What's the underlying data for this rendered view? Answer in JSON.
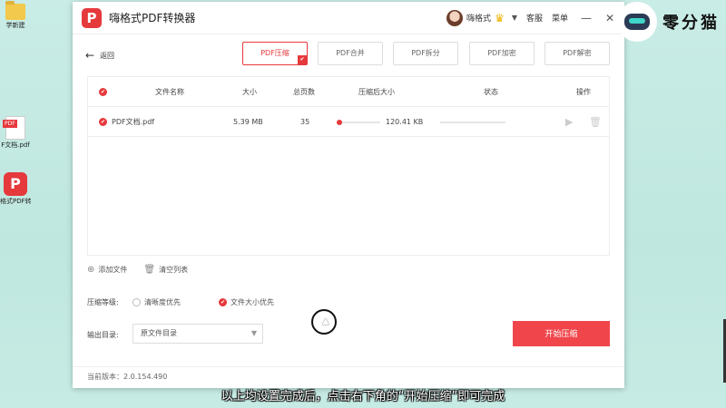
{
  "desktop": {
    "icons": [
      {
        "label": "学新建",
        "icon": "folder-icon"
      },
      {
        "label": "F文档.pdf",
        "icon": "pdf-file-icon",
        "badge": "PDF"
      },
      {
        "label": "格式PDF转换器",
        "icon": "app-icon"
      }
    ]
  },
  "window": {
    "logo_glyph": "P",
    "title": "嗨格式PDF转换器",
    "user": {
      "name": "嗨格式"
    },
    "links": {
      "support": "客服",
      "menu": "菜单"
    },
    "controls": {
      "minimize": "—",
      "close": "✕"
    }
  },
  "toolbar": {
    "back_label": "返回",
    "tabs": [
      "PDF压缩",
      "PDF合并",
      "PDF拆分",
      "PDF加密",
      "PDF解密"
    ],
    "active_tab": 0
  },
  "table": {
    "headers": [
      "文件名称",
      "大小",
      "总页数",
      "压缩后大小",
      "状态",
      "操作"
    ],
    "rows": [
      {
        "name": "PDF文档.pdf",
        "size": "5.39 MB",
        "pages": "35",
        "compressed_size": "120.41 KB",
        "progress": 0
      }
    ]
  },
  "actions": {
    "add_file": "添加文件",
    "clear_list": "清空列表"
  },
  "compression": {
    "label": "压缩等级:",
    "options": [
      "清晰度优先",
      "文件大小优先"
    ],
    "selected": 1
  },
  "output": {
    "label": "输出目录:",
    "value": "原文件目录"
  },
  "start_button": "开始压缩",
  "version": "当前版本：2.0.154.490",
  "watermark": {
    "text": "零分猫"
  },
  "subtitle": "以上均设置完成后，点击右下角的“开始压缩”即可完成",
  "colors": {
    "accent": "#e6393c",
    "button": "#f0464b"
  }
}
